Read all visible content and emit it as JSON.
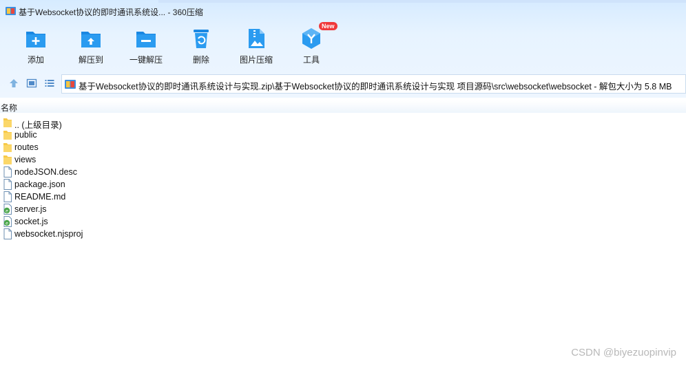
{
  "window": {
    "title": "基于Websocket协议的即时通讯系统设... - 360压缩",
    "app_icon": "archive-app-icon"
  },
  "toolbar": {
    "items": [
      {
        "label": "添加",
        "icon": "add-folder-icon"
      },
      {
        "label": "解压到",
        "icon": "extract-to-folder-icon"
      },
      {
        "label": "一键解压",
        "icon": "one-click-extract-icon"
      },
      {
        "label": "删除",
        "icon": "recycle-bin-icon"
      },
      {
        "label": "图片压缩",
        "icon": "image-compress-icon"
      },
      {
        "label": "工具",
        "icon": "tools-cube-icon",
        "badge": "New"
      }
    ]
  },
  "nav": {
    "up_icon": "up-arrow-icon",
    "view_icon": "thumbnail-view-icon",
    "list_icon": "list-view-icon",
    "address": "基于Websocket协议的即时通讯系统设计与实现.zip\\基于Websocket协议的即时通讯系统设计与实现 项目源码\\src\\websocket\\websocket - 解包大小为 5.8 MB"
  },
  "list": {
    "column_name": "名称",
    "items": [
      {
        "name": ".. (上级目录)",
        "type": "folder"
      },
      {
        "name": "public",
        "type": "folder"
      },
      {
        "name": "routes",
        "type": "folder"
      },
      {
        "name": "views",
        "type": "folder"
      },
      {
        "name": "nodeJSON.desc",
        "type": "file"
      },
      {
        "name": "package.json",
        "type": "file"
      },
      {
        "name": "README.md",
        "type": "file"
      },
      {
        "name": "server.js",
        "type": "js"
      },
      {
        "name": "socket.js",
        "type": "js"
      },
      {
        "name": "websocket.njsproj",
        "type": "file"
      }
    ]
  },
  "watermark": "CSDN @biyezuopinvip",
  "colors": {
    "accent": "#1e8fe6",
    "badge": "#f0383a",
    "folder": "#f7c948"
  }
}
